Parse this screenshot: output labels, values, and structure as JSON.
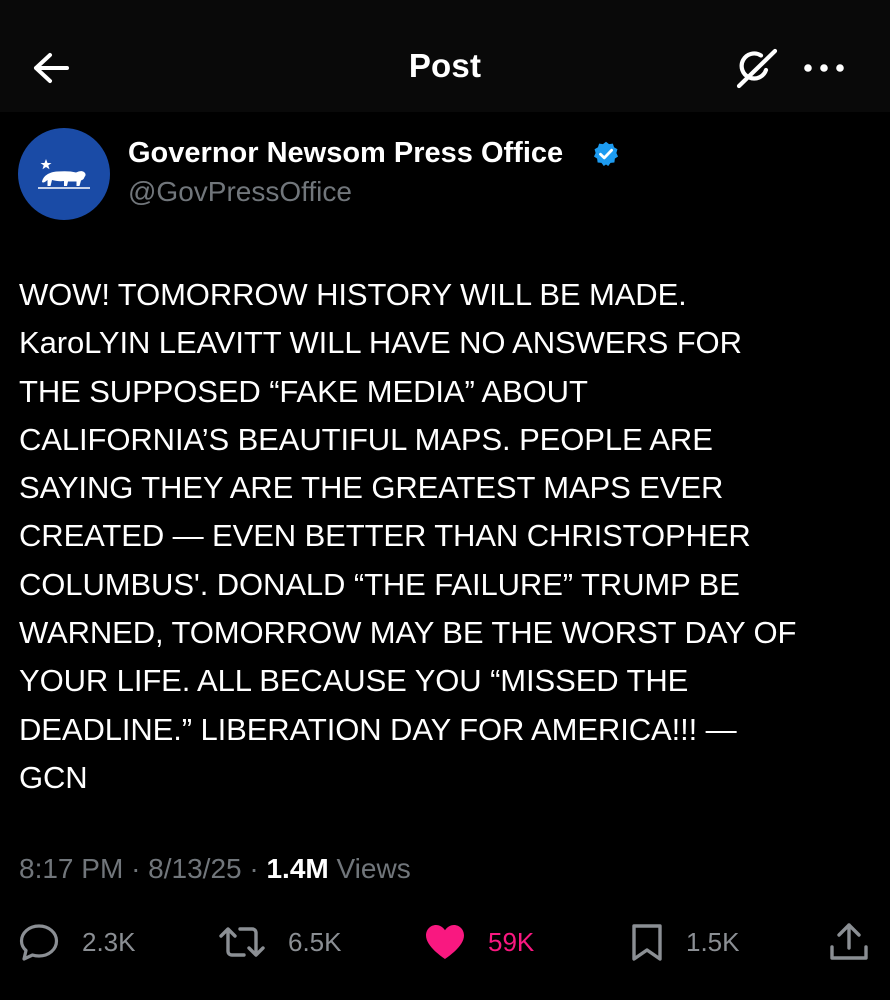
{
  "header": {
    "title": "Post"
  },
  "author": {
    "display_name": "Governor Newsom Press Office",
    "handle": "@GovPressOffice",
    "verified": true,
    "avatar_color": "#1a4ba6"
  },
  "post": {
    "text": "WOW! TOMORROW HISTORY WILL BE MADE.\nKaroLYIN LEAVITT WILL HAVE NO ANSWERS FOR\nTHE SUPPOSED “FAKE MEDIA” ABOUT\nCALIFORNIA’S BEAUTIFUL MAPS. PEOPLE ARE\nSAYING THEY ARE THE GREATEST MAPS EVER\nCREATED — EVEN BETTER THAN CHRISTOPHER\nCOLUMBUS'. DONALD “THE FAILURE” TRUMP BE\nWARNED, TOMORROW MAY BE THE WORST DAY OF\nYOUR LIFE. ALL BECAUSE YOU “MISSED THE\nDEADLINE.”  LIBERATION DAY FOR AMERICA!!! —\nGCN",
    "time": "8:17 PM",
    "separator": "·",
    "date": "8/13/25",
    "views_count": "1.4M",
    "views_label": "Views"
  },
  "actions": {
    "replies": "2.3K",
    "reposts": "6.5K",
    "likes": "59K",
    "bookmarks": "1.5K"
  },
  "colors": {
    "background": "#000000",
    "header_background": "#090909",
    "secondary_text": "#71767b",
    "verified_blue": "#1d9bf0",
    "like_pink": "#f91880"
  },
  "icons": {
    "back": "arrow-left-icon",
    "grok": "grok-icon",
    "more": "more-horizontal-icon",
    "reply": "reply-bubble-icon",
    "repost": "repost-icon",
    "like": "heart-icon",
    "bookmark": "bookmark-icon",
    "share": "share-icon"
  }
}
